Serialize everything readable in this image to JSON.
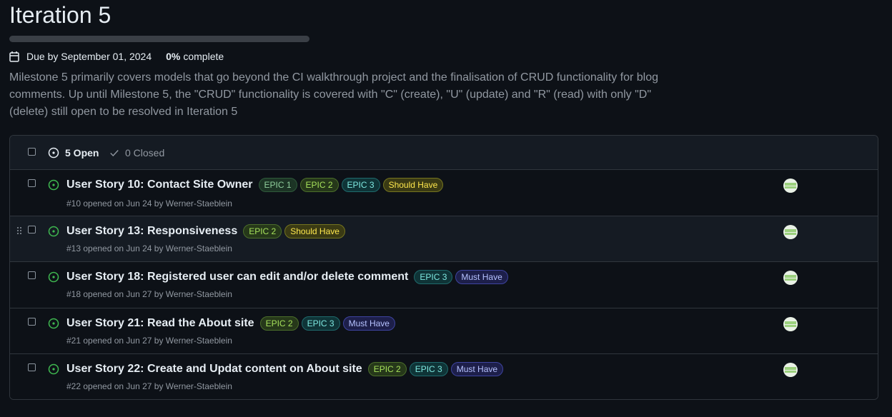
{
  "milestone": {
    "title": "Iteration 5",
    "progress_fraction": 0.0,
    "due": "Due by September 01, 2024",
    "percent": "0%",
    "percent_label": "complete",
    "description": "Milestone 5 primarily covers models that go beyond the CI walkthrough project and the finalisation of CRUD functionality for blog comments. Up until Milestone 5, the \"CRUD\" functionality is covered with \"C\" (create), \"U\" (update) and \"R\" (read) with only \"D\" (delete) still open to be resolved in Iteration 5"
  },
  "list": {
    "open_label": "5 Open",
    "closed_label": "0 Closed",
    "issues": [
      {
        "title": "User Story 10: Contact Site Owner",
        "meta": "#10 opened on Jun 24 by Werner-Staeblein",
        "labels": [
          "EPIC 1",
          "EPIC 2",
          "EPIC 3",
          "Should Have"
        ]
      },
      {
        "title": "User Story 13: Responsiveness",
        "meta": "#13 opened on Jun 24 by Werner-Staeblein",
        "labels": [
          "EPIC 2",
          "Should Have"
        ]
      },
      {
        "title": "User Story 18: Registered user can edit and/or delete comment",
        "meta": "#18 opened on Jun 27 by Werner-Staeblein",
        "labels": [
          "EPIC 3",
          "Must Have"
        ]
      },
      {
        "title": "User Story 21: Read the About site",
        "meta": "#21 opened on Jun 27 by Werner-Staeblein",
        "labels": [
          "EPIC 2",
          "EPIC 3",
          "Must Have"
        ]
      },
      {
        "title": "User Story 22: Create and Updat content on About site",
        "meta": "#22 opened on Jun 27 by Werner-Staeblein",
        "labels": [
          "EPIC 2",
          "EPIC 3",
          "Must Have"
        ]
      }
    ]
  },
  "label_colors": {
    "EPIC 1": {
      "text": "#8fce9c",
      "bg": "#1c3425",
      "border": "#2f5a3b"
    },
    "EPIC 2": {
      "text": "#a6e15b",
      "bg": "#26381a",
      "border": "#4b6e2a"
    },
    "EPIC 3": {
      "text": "#7ee8e0",
      "bg": "#0f3437",
      "border": "#1f6a6c"
    },
    "Should Have": {
      "text": "#ffe84d",
      "bg": "#3a3a14",
      "border": "#75751f"
    },
    "Must Have": {
      "text": "#b6c2ff",
      "bg": "#1d1f4a",
      "border": "#3e44a0"
    }
  },
  "icons": {
    "calendar": "calendar-icon",
    "issue_open": "issue-opened-icon",
    "check": "check-icon",
    "drag": "grabber-icon",
    "avatar": "avatar"
  }
}
